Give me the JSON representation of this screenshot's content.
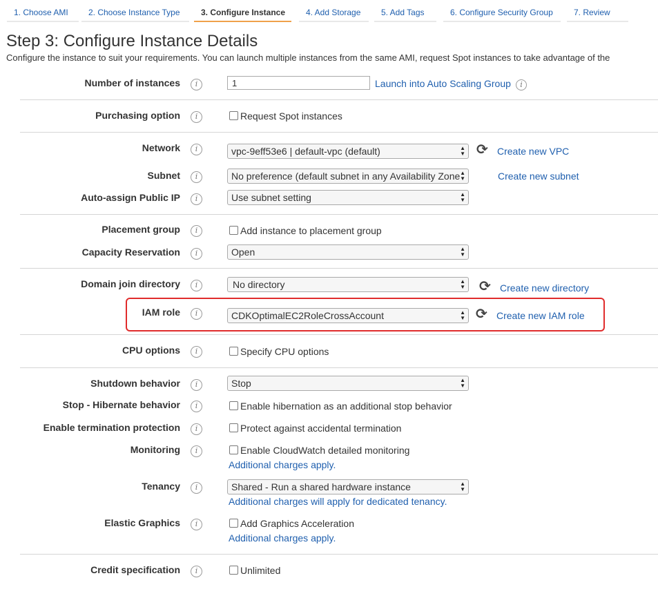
{
  "tabs": [
    {
      "label": "1. Choose AMI"
    },
    {
      "label": "2. Choose Instance Type"
    },
    {
      "label": "3. Configure Instance"
    },
    {
      "label": "4. Add Storage"
    },
    {
      "label": "5. Add Tags"
    },
    {
      "label": "6. Configure Security Group"
    },
    {
      "label": "7. Review"
    }
  ],
  "page": {
    "title": "Step 3: Configure Instance Details",
    "description": "Configure the instance to suit your requirements. You can launch multiple instances from the same AMI, request Spot instances to take advantage of the"
  },
  "info_glyph": "i",
  "refresh_glyph": "⟳",
  "fields": {
    "num_instances": {
      "label": "Number of instances",
      "value": "1",
      "link": "Launch into Auto Scaling Group"
    },
    "purchasing": {
      "label": "Purchasing option",
      "checkbox": "Request Spot instances"
    },
    "network": {
      "label": "Network",
      "value": "vpc-9eff53e6 | default-vpc (default)",
      "link": "Create new VPC"
    },
    "subnet": {
      "label": "Subnet",
      "value": "No preference (default subnet in any Availability Zone",
      "link": "Create new subnet"
    },
    "public_ip": {
      "label": "Auto-assign Public IP",
      "value": "Use subnet setting"
    },
    "placement": {
      "label": "Placement group",
      "checkbox": "Add instance to placement group"
    },
    "capacity": {
      "label": "Capacity Reservation",
      "value": "Open"
    },
    "domain": {
      "label": "Domain join directory",
      "value": "No directory",
      "link": "Create new directory"
    },
    "iam": {
      "label": "IAM role",
      "value": "CDKOptimalEC2RoleCrossAccount",
      "link": "Create new IAM role"
    },
    "cpu": {
      "label": "CPU options",
      "checkbox": "Specify CPU options"
    },
    "shutdown": {
      "label": "Shutdown behavior",
      "value": "Stop"
    },
    "hibernate": {
      "label": "Stop - Hibernate behavior",
      "checkbox": "Enable hibernation as an additional stop behavior"
    },
    "termination": {
      "label": "Enable termination protection",
      "checkbox": "Protect against accidental termination"
    },
    "monitoring": {
      "label": "Monitoring",
      "checkbox": "Enable CloudWatch detailed monitoring",
      "note": "Additional charges apply."
    },
    "tenancy": {
      "label": "Tenancy",
      "value": "Shared - Run a shared hardware instance",
      "note": "Additional charges will apply for dedicated tenancy."
    },
    "graphics": {
      "label": "Elastic Graphics",
      "checkbox": "Add Graphics Acceleration",
      "note": "Additional charges apply."
    },
    "credit": {
      "label": "Credit specification",
      "checkbox": "Unlimited"
    }
  },
  "colors": {
    "link": "#1f5fae",
    "active_tab": "#f0a14a",
    "highlight": "#e02b2b"
  }
}
